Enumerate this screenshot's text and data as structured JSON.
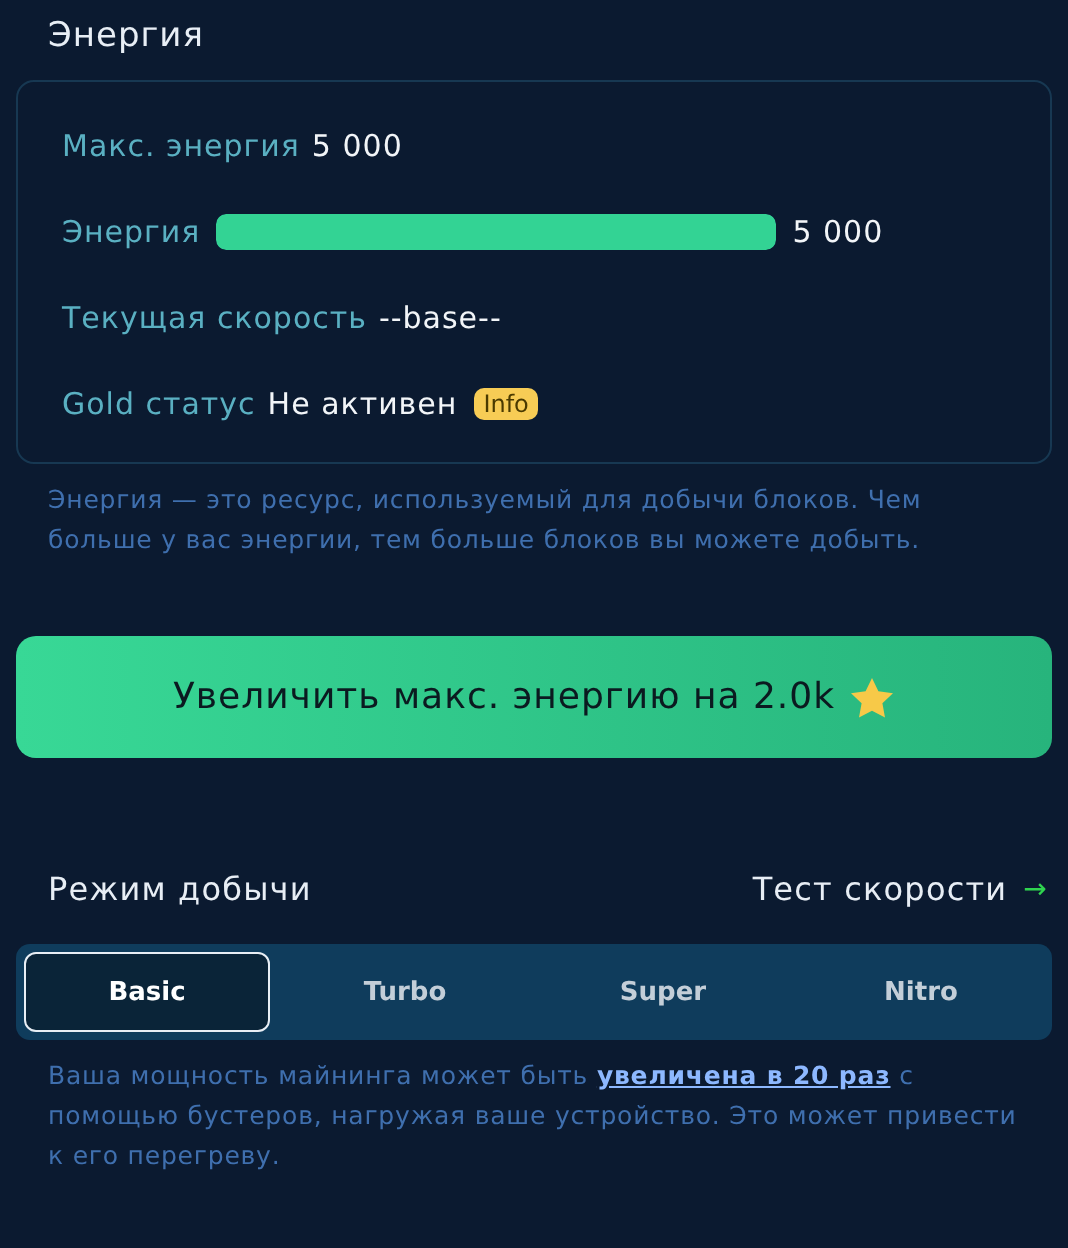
{
  "energy": {
    "title": "Энергия",
    "max": {
      "label": "Макс. энергия",
      "value": "5 000"
    },
    "current": {
      "label": "Энергия",
      "level": 1,
      "value": "5 000"
    },
    "speed": {
      "label": "Текущая скорость",
      "value": "--base--"
    },
    "gold": {
      "label": "Gold статус",
      "value": "Не активен",
      "badge": "Info"
    },
    "note": "Энергия — это ресурс, используемый для добычи блоков. Чем больше у вас энергии, тем больше блоков вы можете добыть."
  },
  "upgrade_button": {
    "label": "Увеличить макс. энергию на 2.0k"
  },
  "mining": {
    "title": "Режим добычи",
    "speed_test": {
      "label": "Тест скорости",
      "arrow": "→"
    },
    "tabs": [
      {
        "label": "Basic",
        "selected": true
      },
      {
        "label": "Turbo",
        "selected": false
      },
      {
        "label": "Super",
        "selected": false
      },
      {
        "label": "Nitro",
        "selected": false
      }
    ],
    "note": {
      "before": "Ваша мощность майнинга может быть",
      "link": "увеличена в 20 раз",
      "after": "с помощью бустеров, нагружая ваше устройство. Это может привести к его перегреву."
    }
  }
}
